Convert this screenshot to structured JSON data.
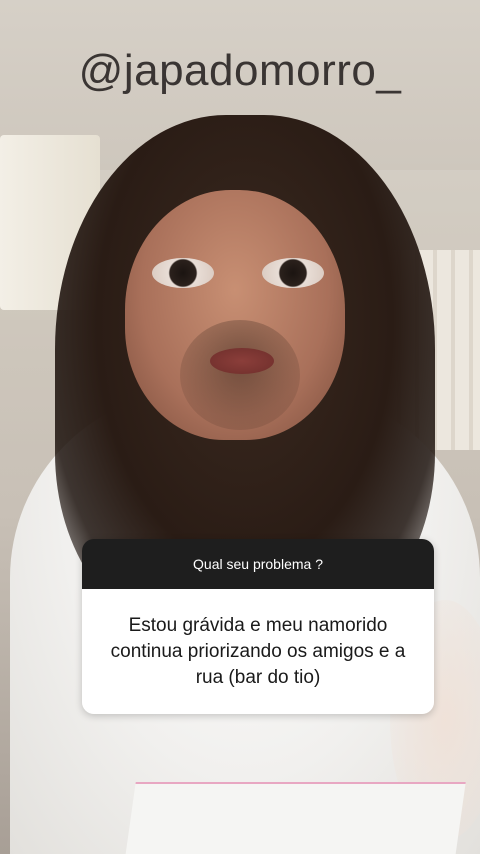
{
  "story": {
    "username": "@japadomorro_"
  },
  "question_sticker": {
    "question": "Qual seu problema ?",
    "answer": "Estou grávida e meu namorido continua priorizando os amigos e a rua (bar do tio)"
  }
}
